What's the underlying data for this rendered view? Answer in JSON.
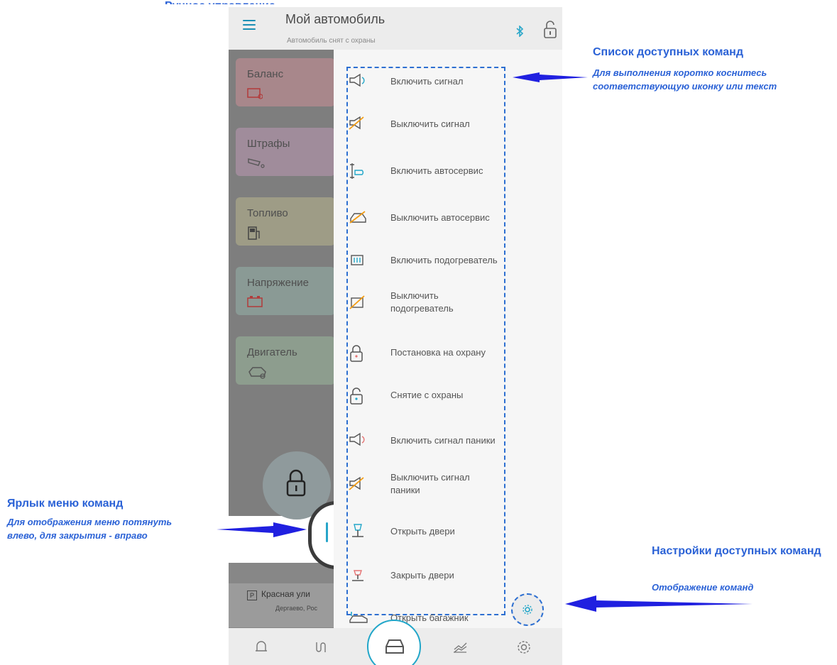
{
  "page_header": "Ручное управление",
  "app": {
    "title": "Мой автомобиль",
    "subtitle": "Автомобиль снят с охраны"
  },
  "cards": [
    {
      "label": "Баланс",
      "icon": "wallet-icon",
      "bg": "#a8878b"
    },
    {
      "label": "Штрафы",
      "icon": "camera-icon",
      "bg": "#a08c9b"
    },
    {
      "label": "Топливо",
      "icon": "fuel-icon",
      "bg": "#9e9c86"
    },
    {
      "label": "Напряжение",
      "icon": "battery-icon",
      "bg": "#8a9a95"
    },
    {
      "label": "Двигатель",
      "icon": "engine-icon",
      "bg": "#8d9d8e"
    }
  ],
  "address": {
    "badge": "P",
    "line1": "Красная ули",
    "line2": "Дергаево, Рос"
  },
  "commands": [
    {
      "label": "Включить сигнал",
      "icon": "horn-on-icon"
    },
    {
      "label": "Выключить сигнал",
      "icon": "horn-off-icon"
    },
    {
      "label": "Включить автосервис",
      "icon": "service-on-icon"
    },
    {
      "label": "Выключить автосервис",
      "icon": "service-off-icon"
    },
    {
      "label": "Включить подогреватель",
      "icon": "heater-on-icon"
    },
    {
      "label": "Выключить\nподогреватель",
      "icon": "heater-off-icon"
    },
    {
      "label": "Постановка на охрану",
      "icon": "lock-closed-icon"
    },
    {
      "label": "Снятие с охраны",
      "icon": "lock-open-icon"
    },
    {
      "label": "Включить сигнал паники",
      "icon": "panic-on-icon"
    },
    {
      "label": "Выключить сигнал\nпаники",
      "icon": "panic-off-icon"
    },
    {
      "label": "Открыть двери",
      "icon": "door-open-icon"
    },
    {
      "label": "Закрыть двери",
      "icon": "door-close-icon"
    },
    {
      "label": "Открыть багажник",
      "icon": "trunk-open-icon"
    }
  ],
  "annotations": {
    "commands_title": "Список доступных команд",
    "commands_desc": "Для выполнения коротко коснитесь соответствующую иконку или текст",
    "menu_title": "Ярлык меню команд",
    "menu_desc": "Для отображения меню потянуть влево, для закрытия - вправо",
    "settings_title": "Настройки доступных команд",
    "settings_desc": "Отображение команд"
  },
  "colors": {
    "accent": "#21a6c9",
    "annotation": "#2b62d6",
    "icon_orange": "#f39c12"
  }
}
